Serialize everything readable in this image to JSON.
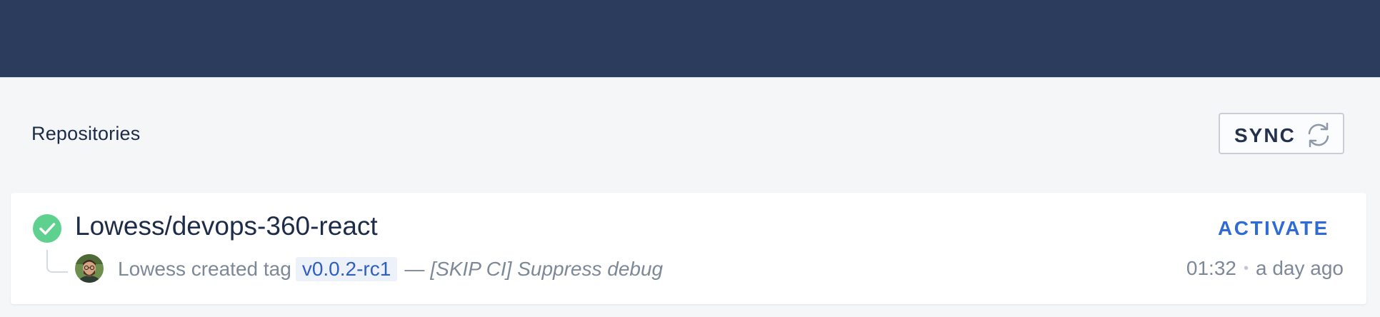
{
  "header": {
    "section_title": "Repositories",
    "sync_label": "SYNC",
    "sync_icon": "sync-icon"
  },
  "repository": {
    "name": "Lowess/devops-360-react",
    "status": "success",
    "status_icon": "check-circle-icon",
    "action_label": "ACTIVATE",
    "last_event": {
      "author_text": "Lowess created tag",
      "tag": "v0.0.2-rc1",
      "separator": "—",
      "message": "[SKIP CI] Suppress debug",
      "time": "01:32",
      "dot": "•",
      "relative_time": "a day ago"
    }
  },
  "colors": {
    "topbar": "#2b3c5c",
    "success": "#5fd18f",
    "accent": "#2f6bd6"
  }
}
